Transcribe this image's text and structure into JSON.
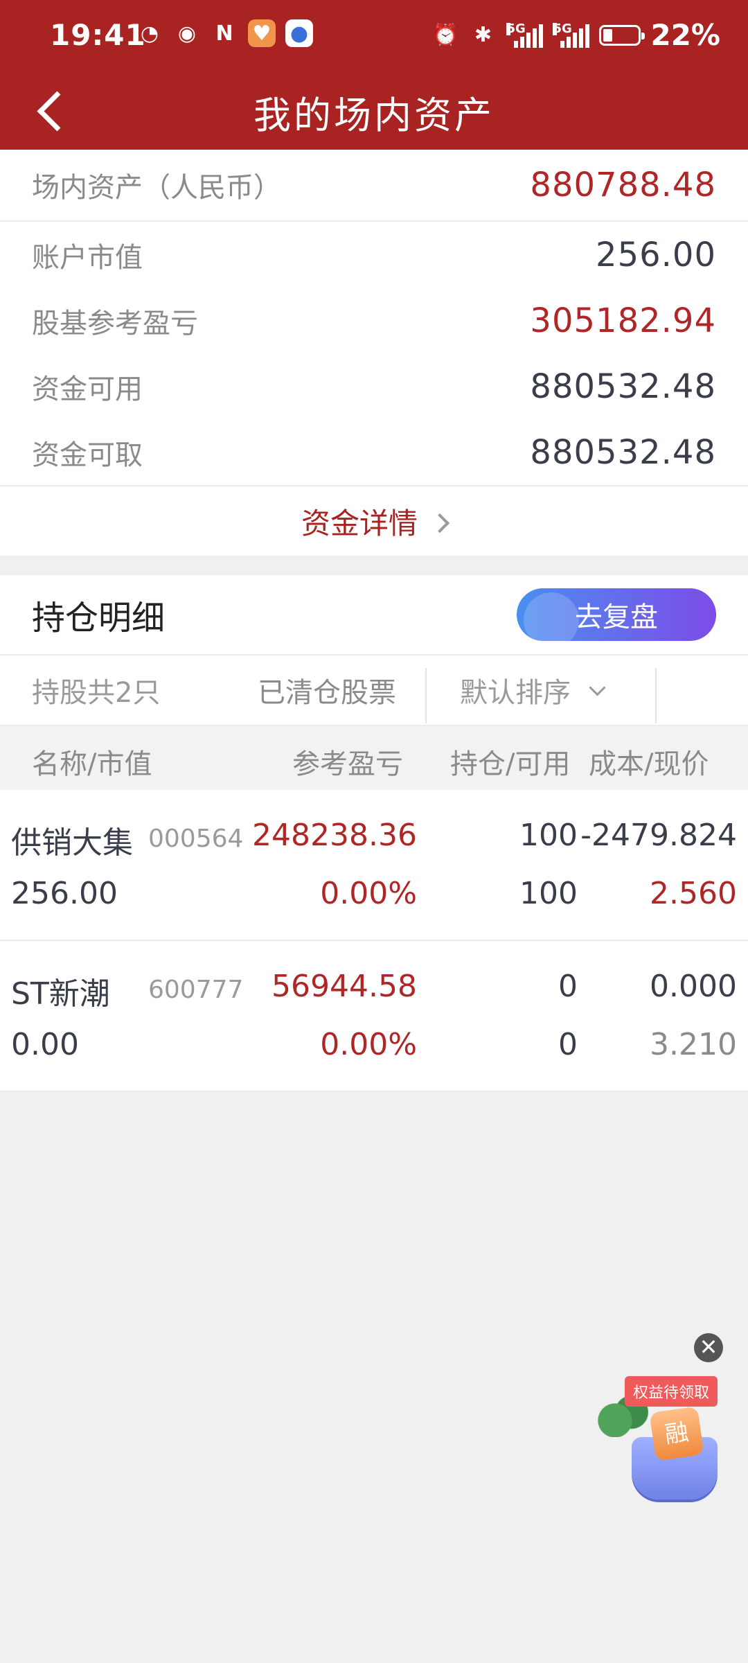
{
  "status_bar": {
    "time": "19:41",
    "battery": "22%",
    "network_1": "5G",
    "network_2": "5G",
    "battery_level": 0.22
  },
  "header": {
    "title": "我的场内资产"
  },
  "assets": {
    "total_label": "场内资产（人民币）",
    "total_value": "880788.48",
    "items": [
      {
        "label": "账户市值",
        "value": "256.00"
      },
      {
        "label": "股基参考盈亏",
        "value": "305182.94"
      },
      {
        "label": "资金可用",
        "value": "880532.48"
      },
      {
        "label": "资金可取",
        "value": "880532.48"
      }
    ],
    "detail_link": "资金详情"
  },
  "holdings": {
    "title": "持仓明细",
    "review_button": "去复盘",
    "count_text": "持股共2只",
    "cleared_text": "已清仓股票",
    "sort_text": "默认排序",
    "columns": {
      "name": "名称/市值",
      "pnl": "参考盈亏",
      "position": "持仓/可用",
      "cost": "成本/现价"
    },
    "stocks": [
      {
        "name": "供销大集",
        "code": "000564",
        "market_value": "256.00",
        "pnl": "248238.36",
        "pnl_pct": "0.00%",
        "position": "100",
        "available": "100",
        "cost": "-2479.824",
        "price": "2.560"
      },
      {
        "name": "ST新潮",
        "code": "600777",
        "market_value": "0.00",
        "pnl": "56944.58",
        "pnl_pct": "0.00%",
        "position": "0",
        "available": "0",
        "cost": "0.000",
        "price": "3.210"
      }
    ]
  },
  "promo": {
    "tag": "权益待领取",
    "badge": "融",
    "close": "✕"
  },
  "colors": {
    "brand_red": "#a82322",
    "value_red": "#b02525",
    "review_gradient_start": "#4a8ff0",
    "review_gradient_end": "#7d4ce8"
  }
}
